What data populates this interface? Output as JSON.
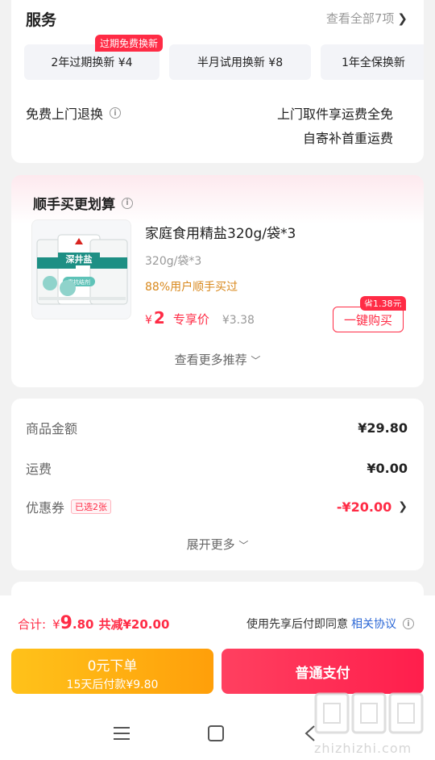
{
  "service": {
    "title": "服务",
    "view_all": "查看全部7项",
    "chips": [
      {
        "label": "2年过期换新  ¥4"
      },
      {
        "label": "半月试用换新  ¥8"
      },
      {
        "label": "1年全保换新"
      }
    ],
    "chip_tag": "过期免费换新",
    "free_return_label": "免费上门退换",
    "free_return_line1": "上门取件享运费全免",
    "free_return_line2": "自寄补首重运费"
  },
  "addon": {
    "title": "顺手买更划算",
    "product": {
      "name": "家庭食用精盐320g/袋*3",
      "spec": "320g/袋*3",
      "buy_rate": "88%用户顺手买过",
      "price_symbol": "¥",
      "price": "2",
      "price_label": "专享价",
      "original_price": "¥3.38",
      "save_badge": "省1.38元",
      "buy_button": "一键购买",
      "brand_text": "深井盐",
      "package_note": "零抗结剂"
    },
    "more": "查看更多推荐"
  },
  "amount": {
    "rows": [
      {
        "label": "商品金额",
        "value": "¥29.80"
      },
      {
        "label": "运费",
        "value": "¥0.00"
      },
      {
        "label": "优惠券",
        "badge": "已选2张",
        "value": "-¥20.00"
      }
    ],
    "expand": "展开更多"
  },
  "bottom": {
    "total_label": "合计:",
    "total_symbol": "¥",
    "total_int": "9",
    "total_dec": ".80",
    "total_cut": "共减¥20.00",
    "agree_text": "使用先享后付即同意",
    "agree_link": "相关协议",
    "zero_line1": "0元下单",
    "zero_line2": "15天后付款¥9.80",
    "pay_button": "普通支付"
  },
  "watermark": {
    "url": "zhizhizhi.com",
    "logo_text": "值值值"
  },
  "colors": {
    "accent_red": "#ff2b45",
    "orange_text": "#d8881c",
    "link_blue": "#2b67d6",
    "yellow_button": "#ffb412"
  },
  "icons": [
    "info-icon",
    "chevron-right-icon",
    "chevron-down-icon",
    "menu-icon",
    "home-square-icon",
    "back-icon"
  ]
}
